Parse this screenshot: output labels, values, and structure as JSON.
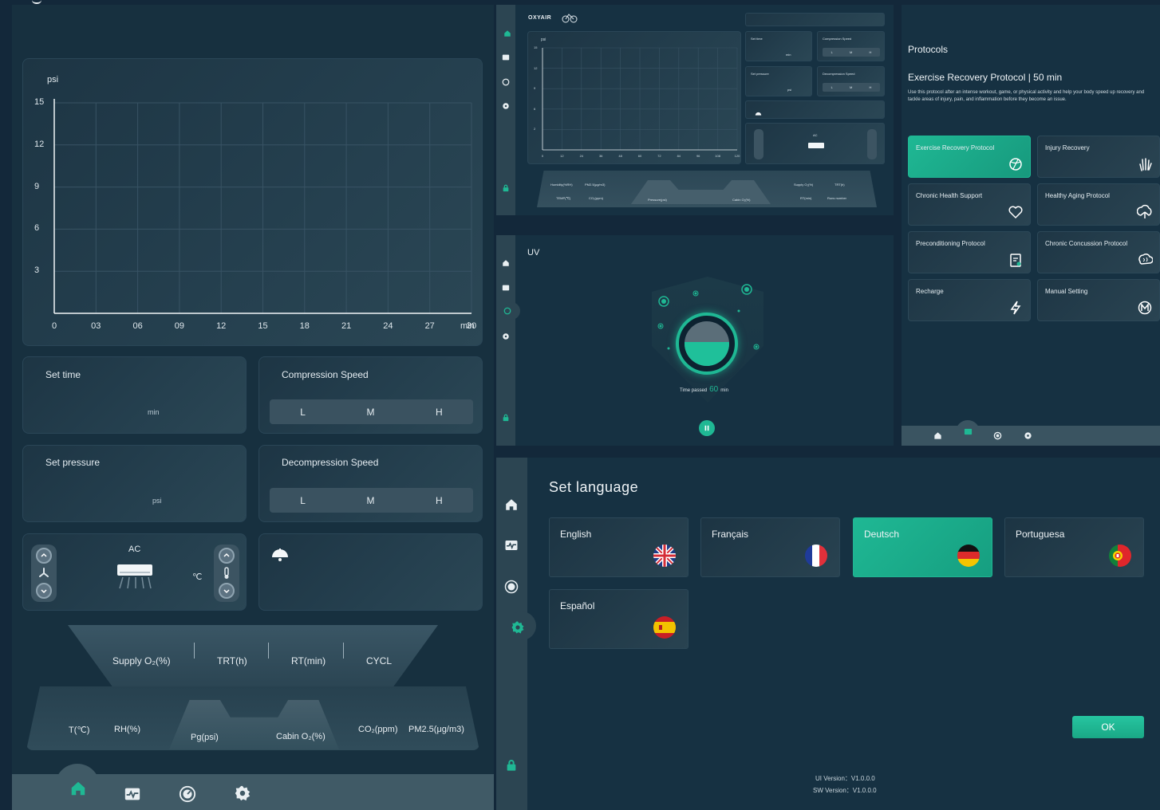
{
  "colors": {
    "accent": "#1fb894",
    "bg": "#13283a",
    "panel": "#17303f"
  },
  "main": {
    "chart": {
      "unit": "psi",
      "y_ticks": [
        "15",
        "12",
        "9",
        "6",
        "3"
      ],
      "x_ticks": [
        "0",
        "03",
        "06",
        "09",
        "12",
        "15",
        "18",
        "21",
        "24",
        "27",
        "30"
      ],
      "x_unit": "min"
    },
    "set_time": {
      "label": "Set time",
      "unit": "min"
    },
    "compression": {
      "label": "Compression Speed",
      "options": [
        "L",
        "M",
        "H"
      ]
    },
    "set_pressure": {
      "label": "Set pressure",
      "unit": "psi"
    },
    "decompression": {
      "label": "Decompression Speed",
      "options": [
        "L",
        "M",
        "H"
      ]
    },
    "ac": {
      "label": "AC",
      "unit": "℃"
    },
    "stats_top": [
      "Supply O₂(%)",
      "TRT(h)",
      "RT(min)",
      "CYCL"
    ],
    "stats_bottom": [
      "T(℃)",
      "RH(%)",
      "Pg(psi)",
      "Cabin O₂(%)",
      "CO₂(ppm)",
      "PM2.5(μg/m3)"
    ],
    "nav": [
      "home-icon",
      "monitor-icon",
      "gauge-icon",
      "gear-icon"
    ]
  },
  "mini": {
    "brand": "OXYAIR",
    "chart_unit": "psi",
    "y_ticks": [
      "15",
      "12",
      "9",
      "6",
      "2"
    ],
    "x_ticks": [
      "0",
      "12",
      "24",
      "36",
      "48",
      "60",
      "72",
      "84",
      "96",
      "108",
      "120",
      "min"
    ],
    "set_time": "Set time",
    "set_time_unit": "min",
    "compression": "Compression Speed",
    "set_pressure": "Set pressure",
    "set_pressure_unit": "psi",
    "decompression": "Decompression Speed",
    "speed_opts": [
      "L",
      "M",
      "H"
    ],
    "ac": "AC",
    "stats_left_top": [
      "Humidity(%RH)",
      "PM2.5(μg/m3)"
    ],
    "stats_left_bottom": [
      "TEMP(℃)",
      "CO₂(ppm)"
    ],
    "stats_center": [
      "Pressure(psi)",
      "Cabin O₂(%)"
    ],
    "stats_right_top": [
      "Supply O₂(%)",
      "TRT(h)"
    ],
    "stats_right_bottom": [
      "RT(min)",
      "Runs number"
    ]
  },
  "uv": {
    "title": "UV",
    "time_label": "Time passed",
    "time_value": "60",
    "time_unit": "min"
  },
  "protocols": {
    "title": "Protocols",
    "heading": "Exercise Recovery Protocol | 50 min",
    "desc": "Use this protocol after an intense workout, game, or physical activity and help your body speed up recovery and tackle areas of injury, pain, and inflammation before they become an issue.",
    "items": [
      {
        "label": "Exercise Recovery Protocol",
        "icon": "ball-icon"
      },
      {
        "label": "Injury Recovery",
        "icon": "hand-icon"
      },
      {
        "label": "Chronic Health Support",
        "icon": "heart-icon"
      },
      {
        "label": "Healthy Aging Protocol",
        "icon": "tree-icon"
      },
      {
        "label": "Preconditioning Protocol",
        "icon": "clipboard-icon"
      },
      {
        "label": "Chronic Concussion Protocol",
        "icon": "brain-icon"
      },
      {
        "label": "Recharge",
        "icon": "bolt-icon"
      },
      {
        "label": "Manual Setting",
        "icon": "m-icon"
      }
    ]
  },
  "language": {
    "title": "Set language",
    "options": [
      "English",
      "Français",
      "Deutsch",
      "Portuguesa",
      "Español"
    ],
    "selected": "Deutsch",
    "ok": "OK",
    "ui_version": "UI Version：V1.0.0.0",
    "sw_version": "SW Version：V1.0.0.0"
  }
}
